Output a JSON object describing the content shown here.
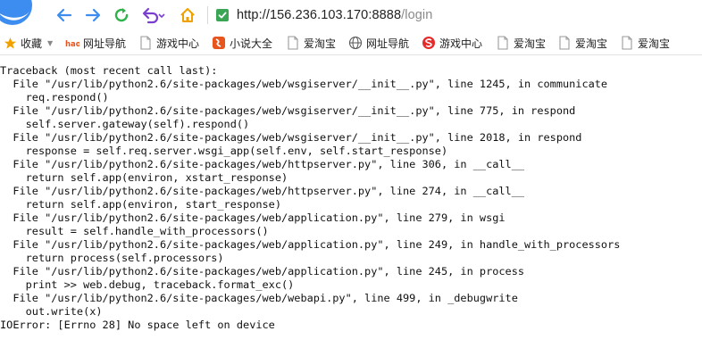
{
  "browser": {
    "url_host": "http://156.236.103.170:8888",
    "url_path": "/login"
  },
  "bookmarks": [
    {
      "label": "收藏",
      "icon": "star-icon",
      "color": "#f0a100"
    },
    {
      "label": "网址导航",
      "icon": "hao-icon",
      "color": "#e8541e"
    },
    {
      "label": "游戏中心",
      "icon": "page-icon",
      "color": "#9a9a9a"
    },
    {
      "label": "小说大全",
      "icon": "novel-icon",
      "color": "#e8541e"
    },
    {
      "label": "爱淘宝",
      "icon": "page-icon",
      "color": "#9a9a9a"
    },
    {
      "label": "网址导航",
      "icon": "globe-icon",
      "color": "#555555"
    },
    {
      "label": "游戏中心",
      "icon": "game-icon",
      "color": "#e52a2a"
    },
    {
      "label": "爱淘宝",
      "icon": "page-icon",
      "color": "#9a9a9a"
    },
    {
      "label": "爱淘宝",
      "icon": "page-icon",
      "color": "#9a9a9a"
    },
    {
      "label": "爱淘宝",
      "icon": "page-icon",
      "color": "#9a9a9a"
    }
  ],
  "traceback": [
    "Traceback (most recent call last):",
    "  File \"/usr/lib/python2.6/site-packages/web/wsgiserver/__init__.py\", line 1245, in communicate",
    "    req.respond()",
    "  File \"/usr/lib/python2.6/site-packages/web/wsgiserver/__init__.py\", line 775, in respond",
    "    self.server.gateway(self).respond()",
    "  File \"/usr/lib/python2.6/site-packages/web/wsgiserver/__init__.py\", line 2018, in respond",
    "    response = self.req.server.wsgi_app(self.env, self.start_response)",
    "  File \"/usr/lib/python2.6/site-packages/web/httpserver.py\", line 306, in __call__",
    "    return self.app(environ, xstart_response)",
    "  File \"/usr/lib/python2.6/site-packages/web/httpserver.py\", line 274, in __call__",
    "    return self.app(environ, start_response)",
    "  File \"/usr/lib/python2.6/site-packages/web/application.py\", line 279, in wsgi",
    "    result = self.handle_with_processors()",
    "  File \"/usr/lib/python2.6/site-packages/web/application.py\", line 249, in handle_with_processors",
    "    return process(self.processors)",
    "  File \"/usr/lib/python2.6/site-packages/web/application.py\", line 245, in process",
    "    print >> web.debug, traceback.format_exc()",
    "  File \"/usr/lib/python2.6/site-packages/web/webapi.py\", line 499, in _debugwrite",
    "    out.write(x)",
    "IOError: [Errno 28] No space left on device"
  ],
  "colors": {
    "nav_blue": "#3d8cf0",
    "refresh_green": "#2db34a",
    "undo_purple": "#7b3fd0",
    "home_orange": "#f0a100",
    "secure_green": "#3aa655"
  }
}
